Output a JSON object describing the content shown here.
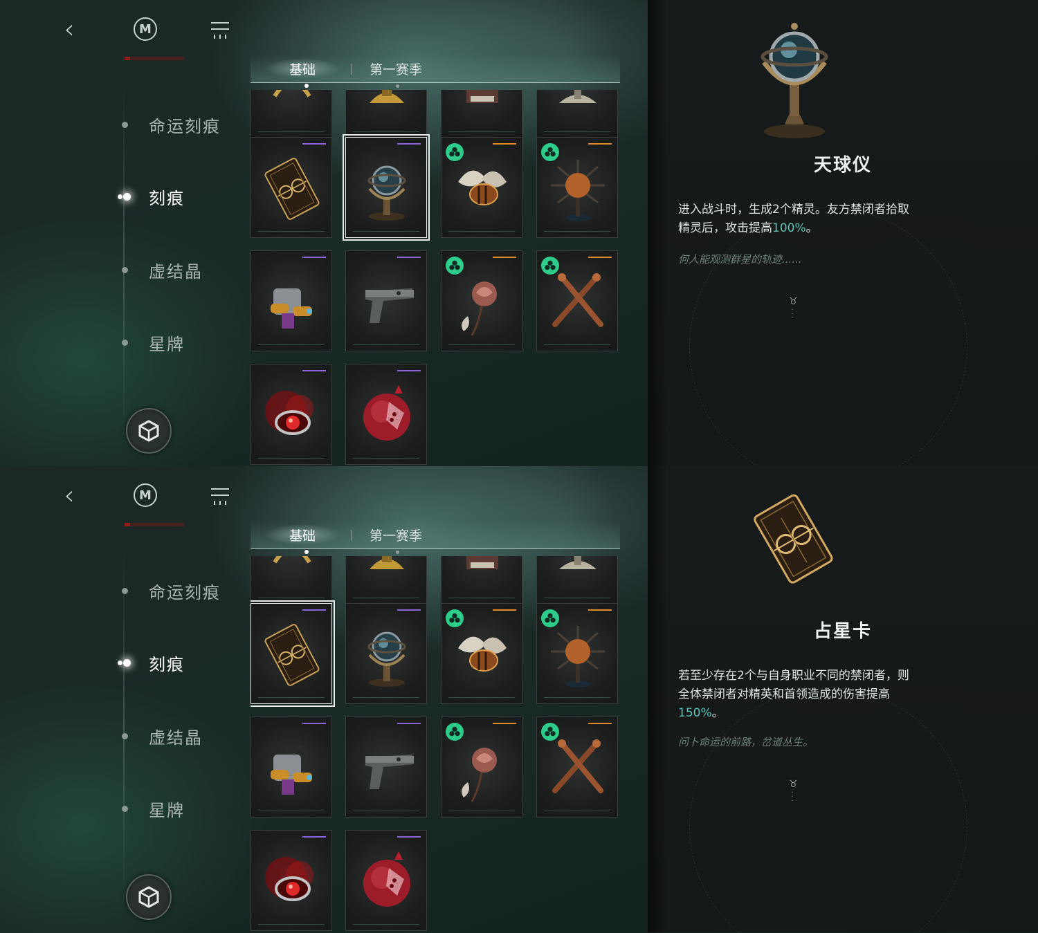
{
  "nav": {
    "items": [
      {
        "label": "命运刻痕"
      },
      {
        "label": "刻痕"
      },
      {
        "label": "虚结晶"
      },
      {
        "label": "星牌"
      }
    ]
  },
  "tabs": [
    {
      "label": "基础"
    },
    {
      "label": "第一赛季"
    }
  ],
  "colors": {
    "accent": "#5dc2b6",
    "rarity_purple": "#8f63d8",
    "rarity_orange": "#e08a2a",
    "badge_green": "#2ecc8a"
  },
  "cards": [
    {
      "name": "astro-card",
      "rarity": "purple"
    },
    {
      "name": "armillary-sphere",
      "rarity": "purple"
    },
    {
      "name": "winged-beetle",
      "rarity": "orange",
      "badge": "clover-icon"
    },
    {
      "name": "spiked-orb",
      "rarity": "orange",
      "badge": "clover-icon"
    },
    {
      "name": "mech-backpack",
      "rarity": "purple"
    },
    {
      "name": "pistol",
      "rarity": "purple"
    },
    {
      "name": "dried-rose",
      "rarity": "orange",
      "badge": "clover-icon"
    },
    {
      "name": "crossed-stakes",
      "rarity": "orange",
      "badge": "clover-icon"
    },
    {
      "name": "blood-eye-ring",
      "rarity": "purple"
    },
    {
      "name": "pomegranate",
      "rarity": "purple"
    }
  ],
  "panels": [
    {
      "selected_card": "armillary-sphere",
      "detail": {
        "title": "天球仪",
        "desc_before": "进入战斗时，生成2个精灵。友方禁闭者拾取精灵后，攻击提高",
        "desc_highlight": "100%",
        "desc_after": "。",
        "flavor": "何人能观测群星的轨迹......"
      }
    },
    {
      "selected_card": "astro-card",
      "detail": {
        "title": "占星卡",
        "desc_before": "若至少存在2个与自身职业不同的禁闭者，则全体禁闭者对精英和首领造成的伤害提高",
        "desc_highlight": "150%",
        "desc_after": "。",
        "flavor": "问卜命运的前路，岔道丛生。"
      }
    }
  ]
}
